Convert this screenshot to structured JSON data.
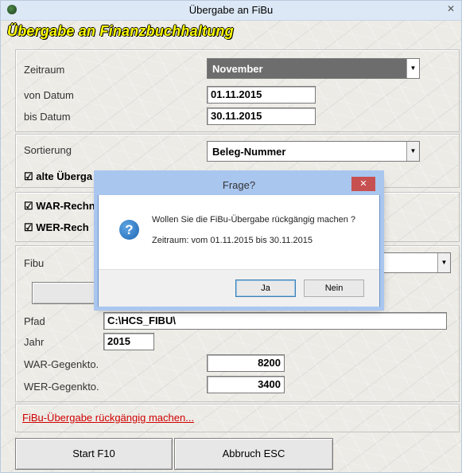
{
  "window": {
    "title": "Übergabe an FiBu",
    "close_glyph": "✕",
    "headline": "Übergabe an Finanzbuchhaltung"
  },
  "period_group": {
    "zeitraum_label": "Zeitraum",
    "zeitraum_value": "November",
    "von_label": "von Datum",
    "von_value": "01.11.2015",
    "bis_label": "bis Datum",
    "bis_value": "30.11.2015"
  },
  "sort_group": {
    "sort_label": "Sortierung",
    "sort_value": "Beleg-Nummer",
    "alte_checkbox_label": "☑ alte Übergabe ... hlen",
    "alte_checkbox_visible": "☑ alte Überga"
  },
  "invoice_group": {
    "war_checkbox_label": "☑ WAR-Rechn",
    "wer_checkbox_label": "☑ WER-Rech"
  },
  "fibu_group": {
    "fibu_label": "Fibu",
    "pfad_label": "Pfad",
    "pfad_value": "C:\\HCS_FIBU\\",
    "jahr_label": "Jahr",
    "jahr_value": "2015",
    "war_gegenkto_label": "WAR-Gegenkto.",
    "war_gegenkto_value": "8200",
    "wer_gegenkto_label": "WER-Gegenkto.",
    "wer_gegenkto_value": "3400"
  },
  "undo_link": "FiBu-Übergabe rückgängig machen...",
  "buttons": {
    "start_label": "Start F10",
    "cancel_label": "Abbruch ESC"
  },
  "dialog": {
    "title": "Frage?",
    "close_glyph": "✕",
    "icon_glyph": "?",
    "message": "Wollen Sie die FiBu-Übergabe rückgängig machen ?",
    "detail": "Zeitraum: vom 01.11.2015 bis 30.11.2015",
    "yes_label": "Ja",
    "no_label": "Nein"
  },
  "colors": {
    "headline": "#ffff00",
    "link": "#d00000",
    "titlebar": "#dce8f6",
    "dialog_frame": "#a9c6ef"
  }
}
